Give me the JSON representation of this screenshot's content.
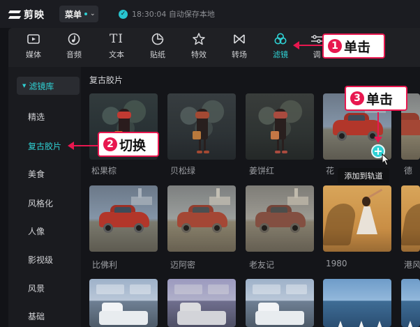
{
  "app": {
    "name": "剪映"
  },
  "topbar": {
    "menu_label": "菜单",
    "save_status": "18:30:04 自动保存本地"
  },
  "toolbar": {
    "tabs": [
      {
        "label": "媒体",
        "icon": "media-icon"
      },
      {
        "label": "音频",
        "icon": "audio-icon"
      },
      {
        "label": "文本",
        "icon": "text-icon"
      },
      {
        "label": "贴纸",
        "icon": "sticker-icon"
      },
      {
        "label": "特效",
        "icon": "effects-icon"
      },
      {
        "label": "转场",
        "icon": "transition-icon"
      },
      {
        "label": "滤镜",
        "icon": "filter-icon",
        "active": true
      },
      {
        "label": "调",
        "icon": "adjust-icon"
      }
    ]
  },
  "sidebar": {
    "header": "滤镜库",
    "items": [
      "精选",
      "复古胶片",
      "美食",
      "风格化",
      "人像",
      "影视级",
      "风景",
      "基础"
    ],
    "active": "复古胶片"
  },
  "content": {
    "section_title": "复古胶片",
    "filters": [
      "松果棕",
      "贝松绿",
      "姜饼红",
      "花",
      "德",
      "比佛利",
      "迈阿密",
      "老友记",
      "1980",
      "港风"
    ],
    "tooltip": "添加到轨道"
  },
  "annotations": [
    {
      "number": "1",
      "text": "单击"
    },
    {
      "number": "2",
      "text": "切换"
    },
    {
      "number": "3",
      "text": "单击"
    }
  ],
  "colors": {
    "accent": "#2fd1d4",
    "annotation": "#e8174f"
  }
}
